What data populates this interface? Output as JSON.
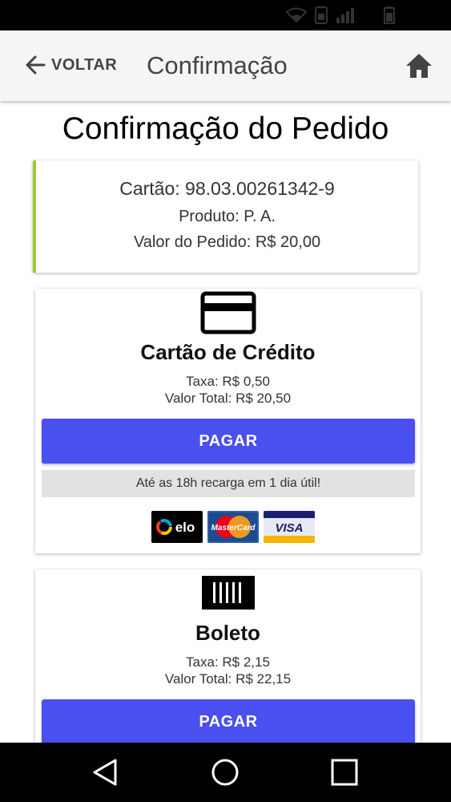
{
  "header": {
    "back_label": "VOLTAR",
    "title": "Confirmação"
  },
  "page_title": "Confirmação do Pedido",
  "summary": {
    "card_number": "Cartão: 98.03.00261342-9",
    "product": "Produto: P. A.",
    "order_value": "Valor do Pedido: R$ 20,00"
  },
  "payment_methods": [
    {
      "icon": "credit-card-icon",
      "name": "Cartão de Crédito",
      "fee": "Taxa: R$  0,50",
      "total": "Valor Total: R$  20,50",
      "button_label": "PAGAR",
      "info": "Até as 18h recarga em 1 dia útil!",
      "brands": [
        {
          "name": "elo",
          "label": "elo"
        },
        {
          "name": "mastercard",
          "label": "MasterCard"
        },
        {
          "name": "visa",
          "label": "VISA"
        }
      ]
    },
    {
      "icon": "barcode-icon",
      "name": "Boleto",
      "fee": "Taxa: R$  2,15",
      "total": "Valor Total: R$  22,15",
      "button_label": "PAGAR"
    }
  ],
  "colors": {
    "accent_button": "#4a4ff0",
    "summary_border": "#9acd32",
    "app_bar": "#f5f5f7"
  }
}
